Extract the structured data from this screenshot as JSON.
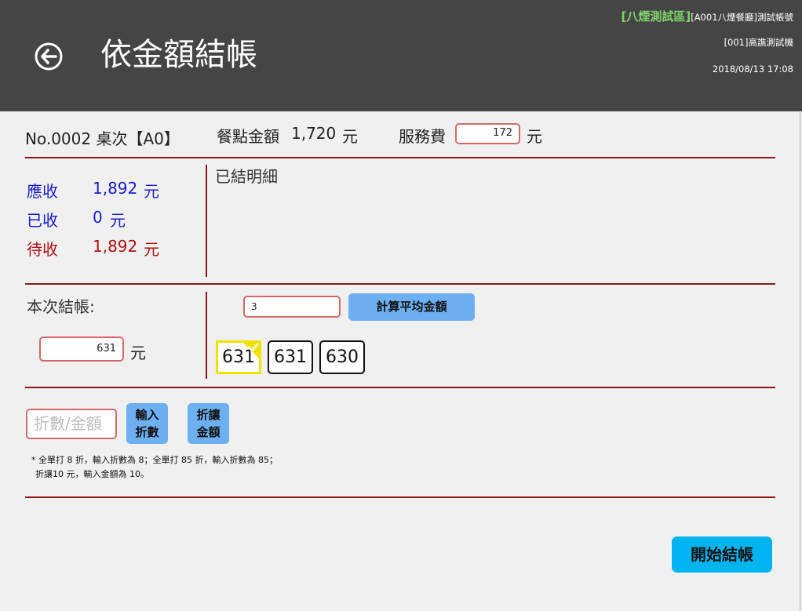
{
  "header": {
    "title": "依金額結帳",
    "zone": "[八煙測試區]",
    "account": "[A001八煙餐廳]測試帳號",
    "device": "[001]高譙測試機",
    "datetime": "2018/08/13 17:08"
  },
  "order": {
    "number_table": "No.0002 桌次【A0】",
    "meal_label": "餐點金額",
    "meal_amount": "1,720",
    "meal_unit": "元",
    "service_label": "服務費",
    "service_value": "172",
    "service_unit": "元"
  },
  "summary": {
    "receivable_label": "應收",
    "receivable_value": "1,892",
    "received_label": "已收",
    "received_value": "0",
    "pending_label": "待收",
    "pending_value": "1,892",
    "unit": "元",
    "details_title": "已結明細"
  },
  "split": {
    "current_label": "本次結帳:",
    "current_value": "631",
    "current_unit": "元",
    "count_value": "3",
    "calc_button": "計算平均金額",
    "amounts": [
      "631",
      "631",
      "630"
    ]
  },
  "discount": {
    "placeholder": "折數/金額",
    "btn_rate": [
      "輸入",
      "折數"
    ],
    "btn_amount": [
      "折讓",
      "金額"
    ],
    "note_line1": "* 全單打 8 折，輸入折數為 8；全單打 85 折，輸入折數為 85；",
    "note_line2": "折讓10 元，輸入金額為 10。"
  },
  "checkout_button": "開始結帳",
  "colors": {
    "header_bg": "#454545",
    "zone_green": "#7fd36b",
    "rule": "#8a1a1a",
    "receivable_blue": "#1a1acc",
    "pending_red": "#b01010",
    "button_blue": "#6cb0f2",
    "checkout_cyan": "#00b4f0",
    "selected_yellow": "#f2e200"
  }
}
